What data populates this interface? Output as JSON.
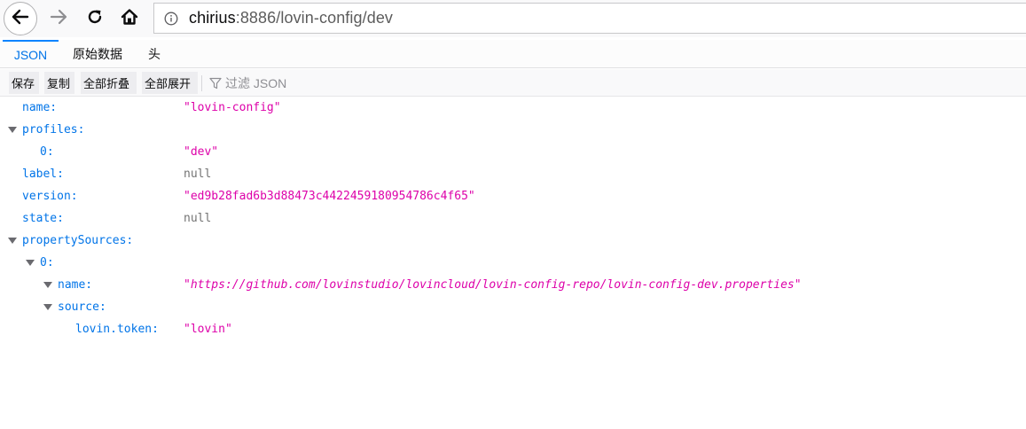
{
  "browser": {
    "url_host": "chirius",
    "url_rest": ":8886/lovin-config/dev",
    "icons": {
      "back": "back-arrow-icon",
      "forward": "forward-arrow-icon",
      "reload": "reload-icon",
      "home": "home-icon",
      "info": "info-icon"
    }
  },
  "tabs": {
    "json": "JSON",
    "raw": "原始数据",
    "headers": "头",
    "selected": "JSON"
  },
  "toolbar": {
    "save": "保存",
    "copy": "复制",
    "collapse_all": "全部折叠",
    "expand_all": "全部展开",
    "filter_placeholder": "过滤 JSON"
  },
  "json": {
    "name": {
      "key": "name:",
      "value": "\"lovin-config\""
    },
    "profiles": {
      "key": "profiles:",
      "items": [
        {
          "key": "0:",
          "value": "\"dev\""
        }
      ]
    },
    "label": {
      "key": "label:",
      "value": "null"
    },
    "version": {
      "key": "version:",
      "value": "\"ed9b28fad6b3d88473c4422459180954786c4f65\""
    },
    "state": {
      "key": "state:",
      "value": "null"
    },
    "propertySources": {
      "key": "propertySources:",
      "items": [
        {
          "key": "0:",
          "name": {
            "key": "name:",
            "value": "\"https://github.com/lovinstudio/lovincloud/lovin-config-repo/lovin-config-dev.properties\""
          },
          "source": {
            "key": "source:",
            "entries": [
              {
                "key": "lovin.token:",
                "value": "\"lovin\""
              }
            ]
          }
        }
      ]
    }
  },
  "colors": {
    "key": "#0074e8",
    "string": "#dd00a9",
    "null": "#737373",
    "selected_tab": "#0074e8"
  }
}
